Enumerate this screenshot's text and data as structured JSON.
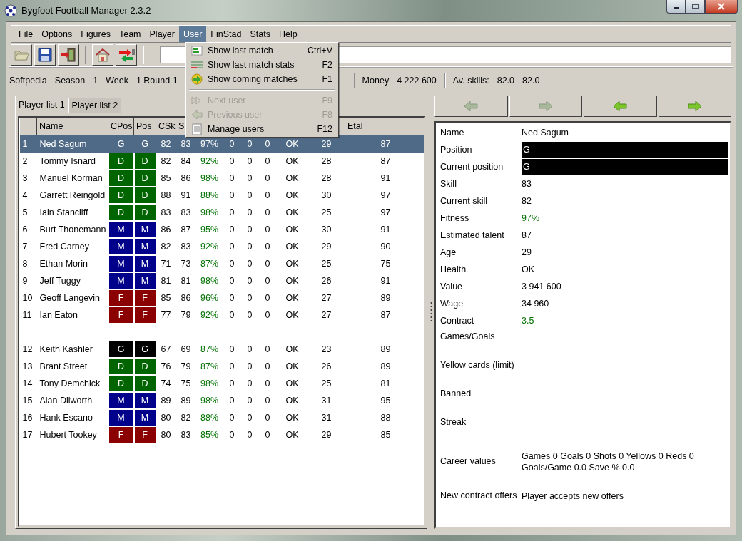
{
  "window": {
    "title": "Bygfoot Football Manager 2.3.2"
  },
  "menu_bar": [
    {
      "label": "File",
      "selected": false
    },
    {
      "label": "Options",
      "selected": false
    },
    {
      "label": "Figures",
      "selected": false
    },
    {
      "label": "Team",
      "selected": false
    },
    {
      "label": "Player",
      "selected": false
    },
    {
      "label": "User",
      "selected": true
    },
    {
      "label": "FinStad",
      "selected": false
    },
    {
      "label": "Stats",
      "selected": false
    },
    {
      "label": "Help",
      "selected": false
    }
  ],
  "open_menu": [
    {
      "kind": "item",
      "label": "Show last match",
      "shortcut": "Ctrl+V",
      "disabled": false
    },
    {
      "kind": "item",
      "label": "Show last match stats",
      "shortcut": "F2",
      "disabled": false
    },
    {
      "kind": "item",
      "label": "Show coming matches",
      "shortcut": "F1",
      "disabled": false
    },
    {
      "kind": "separator"
    },
    {
      "kind": "item",
      "label": "Next user",
      "shortcut": "F9",
      "disabled": true
    },
    {
      "kind": "item",
      "label": "Previous user",
      "shortcut": "F8",
      "disabled": true
    },
    {
      "kind": "item",
      "label": "Manage users",
      "shortcut": "F12",
      "disabled": false
    }
  ],
  "info_bar": {
    "team": "Softpedia",
    "season_label": "Season",
    "season": "1",
    "week_label": "Week",
    "week": "1 Round 1",
    "money_label": "Money",
    "money": "4 222 600",
    "skills_label": "Av. skills:",
    "skill_1": "82.0",
    "skill_2": "82.0"
  },
  "tabs": [
    {
      "label": "Player list 1",
      "selected": true
    },
    {
      "label": "Player list 2",
      "selected": false
    }
  ],
  "table": {
    "columns": [
      "",
      "Name",
      "CPos",
      "Pos",
      "CSk",
      "S",
      "",
      "",
      "",
      "",
      "",
      "",
      "Etal"
    ],
    "rows": [
      {
        "kind": "player",
        "selected": true,
        "cells": [
          "1",
          "Ned Sagum",
          "G",
          "G",
          "82",
          "83",
          "97%",
          "0",
          "0",
          "0",
          "OK",
          "29",
          "87"
        ]
      },
      {
        "kind": "player",
        "selected": false,
        "cells": [
          "2",
          "Tommy Isnard",
          "D",
          "D",
          "82",
          "84",
          "92%",
          "0",
          "0",
          "0",
          "OK",
          "28",
          "87"
        ],
        "color": "#006400"
      },
      {
        "kind": "player",
        "selected": false,
        "cells": [
          "3",
          "Manuel Korman",
          "D",
          "D",
          "85",
          "86",
          "98%",
          "0",
          "0",
          "0",
          "OK",
          "28",
          "91"
        ],
        "color": "#006400"
      },
      {
        "kind": "player",
        "selected": false,
        "cells": [
          "4",
          "Garrett Reingold",
          "D",
          "D",
          "88",
          "91",
          "88%",
          "0",
          "0",
          "0",
          "OK",
          "30",
          "97"
        ],
        "color": "#006400"
      },
      {
        "kind": "player",
        "selected": false,
        "cells": [
          "5",
          "Iain Stancliff",
          "D",
          "D",
          "83",
          "83",
          "98%",
          "0",
          "0",
          "0",
          "OK",
          "25",
          "97"
        ],
        "color": "#006400"
      },
      {
        "kind": "player",
        "selected": false,
        "cells": [
          "6",
          "Burt Thonemann",
          "M",
          "M",
          "86",
          "87",
          "95%",
          "0",
          "0",
          "0",
          "OK",
          "30",
          "91"
        ],
        "color": "#00008b"
      },
      {
        "kind": "player",
        "selected": false,
        "cells": [
          "7",
          "Fred Carney",
          "M",
          "M",
          "82",
          "83",
          "92%",
          "0",
          "0",
          "0",
          "OK",
          "29",
          "90"
        ],
        "color": "#00008b"
      },
      {
        "kind": "player",
        "selected": false,
        "cells": [
          "8",
          "Ethan Morin",
          "M",
          "M",
          "71",
          "73",
          "87%",
          "0",
          "0",
          "0",
          "OK",
          "25",
          "75"
        ],
        "color": "#00008b"
      },
      {
        "kind": "player",
        "selected": false,
        "cells": [
          "9",
          "Jeff Tuggy",
          "M",
          "M",
          "81",
          "81",
          "98%",
          "0",
          "0",
          "0",
          "OK",
          "26",
          "91"
        ],
        "color": "#00008b"
      },
      {
        "kind": "player",
        "selected": false,
        "cells": [
          "10",
          "Geoff Langevin",
          "F",
          "F",
          "85",
          "86",
          "96%",
          "0",
          "0",
          "0",
          "OK",
          "27",
          "89"
        ],
        "color": "#8b0000"
      },
      {
        "kind": "player",
        "selected": false,
        "cells": [
          "11",
          "Ian Eaton",
          "F",
          "F",
          "77",
          "79",
          "92%",
          "0",
          "0",
          "0",
          "OK",
          "27",
          "87"
        ],
        "color": "#8b0000"
      },
      {
        "kind": "spacer"
      },
      {
        "kind": "player",
        "selected": false,
        "cells": [
          "12",
          "Keith Kashler",
          "G",
          "G",
          "67",
          "69",
          "87%",
          "0",
          "0",
          "0",
          "OK",
          "23",
          "89"
        ],
        "color": "#000000"
      },
      {
        "kind": "player",
        "selected": false,
        "cells": [
          "13",
          "Brant Street",
          "D",
          "D",
          "76",
          "79",
          "87%",
          "0",
          "0",
          "0",
          "OK",
          "26",
          "89"
        ],
        "color": "#006400"
      },
      {
        "kind": "player",
        "selected": false,
        "cells": [
          "14",
          "Tony Demchick",
          "D",
          "D",
          "74",
          "75",
          "98%",
          "0",
          "0",
          "0",
          "OK",
          "25",
          "81"
        ],
        "color": "#006400"
      },
      {
        "kind": "player",
        "selected": false,
        "cells": [
          "15",
          "Alan Dilworth",
          "M",
          "M",
          "89",
          "89",
          "98%",
          "0",
          "0",
          "0",
          "OK",
          "31",
          "95"
        ],
        "color": "#00008b"
      },
      {
        "kind": "player",
        "selected": false,
        "cells": [
          "16",
          "Hank Escano",
          "M",
          "M",
          "80",
          "82",
          "88%",
          "0",
          "0",
          "0",
          "OK",
          "31",
          "88"
        ],
        "color": "#00008b"
      },
      {
        "kind": "player",
        "selected": false,
        "cells": [
          "17",
          "Hubert Tookey",
          "F",
          "F",
          "80",
          "83",
          "85%",
          "0",
          "0",
          "0",
          "OK",
          "29",
          "85"
        ],
        "color": "#8b0000"
      }
    ]
  },
  "nav_buttons": [
    {
      "kind": "left",
      "disabled": true
    },
    {
      "kind": "right",
      "disabled": true
    },
    {
      "kind": "left",
      "disabled": false
    },
    {
      "kind": "right",
      "disabled": false
    }
  ],
  "details": [
    {
      "kind": "plain",
      "label": "Name",
      "value": [
        "Ned Sagum"
      ]
    },
    {
      "kind": "position",
      "label": "Position",
      "value": [
        "G"
      ]
    },
    {
      "kind": "position",
      "label": "Current position",
      "value": [
        "G"
      ]
    },
    {
      "kind": "plain",
      "label": "Skill",
      "value": [
        "83"
      ]
    },
    {
      "kind": "plain",
      "label": "Current skill",
      "value": [
        "82"
      ]
    },
    {
      "kind": "good",
      "label": "Fitness",
      "value": [
        "97%"
      ]
    },
    {
      "kind": "plain",
      "label": "Estimated talent",
      "value": [
        "87"
      ]
    },
    {
      "kind": "plain",
      "label": "Age",
      "value": [
        "29"
      ]
    },
    {
      "kind": "plain",
      "label": "Health",
      "value": [
        "OK"
      ]
    },
    {
      "kind": "plain",
      "label": "Value",
      "value": [
        "3 941 600"
      ]
    },
    {
      "kind": "plain",
      "label": "Wage",
      "value": [
        "34 960"
      ]
    },
    {
      "kind": "good",
      "label": "Contract",
      "value": [
        "3.5"
      ]
    },
    {
      "kind": "tall",
      "label": "Games/Goals"
    },
    {
      "kind": "tall",
      "label": "Yellow cards (limit)"
    },
    {
      "kind": "tall",
      "label": "Banned"
    },
    {
      "kind": "tall",
      "label": "Streak"
    },
    {
      "kind": "tall",
      "label": "Career values",
      "value": [
        "Games 0 Goals 0 Shots 0 Yellows 0 Reds 0",
        "Goals/Game 0.0 Save % 0.0"
      ]
    },
    {
      "kind": "tall",
      "label": "New contract offers",
      "value": [
        "Player accepts new offers"
      ]
    }
  ]
}
